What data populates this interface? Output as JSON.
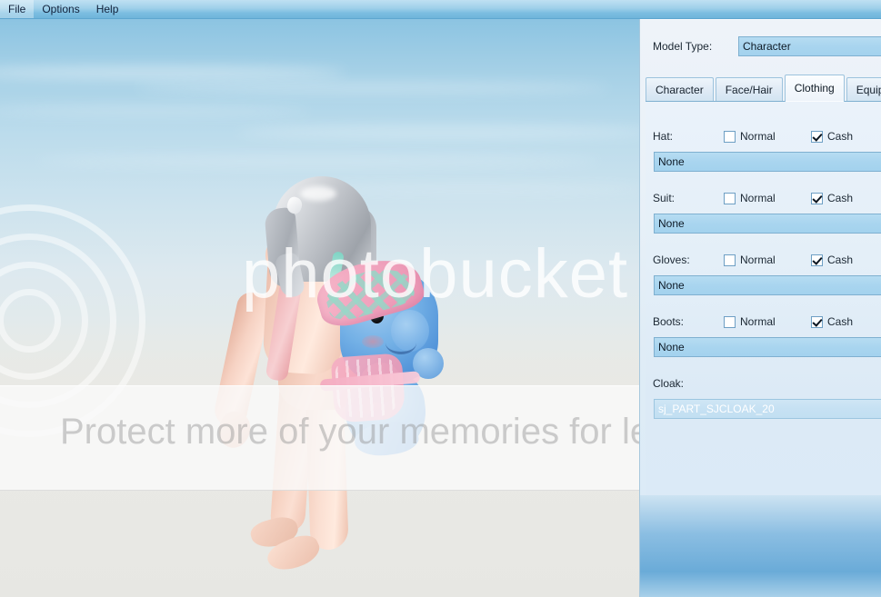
{
  "menubar": {
    "items": [
      {
        "label": "File"
      },
      {
        "label": "Options"
      },
      {
        "label": "Help"
      }
    ]
  },
  "watermark": {
    "brand": "photobucket",
    "tagline": "Protect more of your memories for less!"
  },
  "panel": {
    "model_type": {
      "label": "Model Type:",
      "value": "Character"
    },
    "tabs": [
      {
        "label": "Character",
        "active": false
      },
      {
        "label": "Face/Hair",
        "active": false
      },
      {
        "label": "Clothing",
        "active": true
      },
      {
        "label": "Equipm",
        "active": false
      }
    ],
    "clothing": {
      "slots": [
        {
          "label": "Hat:",
          "normal_label": "Normal",
          "normal_checked": false,
          "cash_label": "Cash",
          "cash_checked": true,
          "value": "None",
          "selected": false
        },
        {
          "label": "Suit:",
          "normal_label": "Normal",
          "normal_checked": false,
          "cash_label": "Cash",
          "cash_checked": true,
          "value": "None",
          "selected": false
        },
        {
          "label": "Gloves:",
          "normal_label": "Normal",
          "normal_checked": false,
          "cash_label": "Cash",
          "cash_checked": true,
          "value": "None",
          "selected": false
        },
        {
          "label": "Boots:",
          "normal_label": "Normal",
          "normal_checked": false,
          "cash_label": "Cash",
          "cash_checked": true,
          "value": "None",
          "selected": false
        }
      ],
      "cloak": {
        "label": "Cloak:",
        "value": "sj_PART_SJCLOAK_20",
        "selected": true
      }
    }
  },
  "colors": {
    "accent": "#6aabd8",
    "panel_bg": "#e4eff8",
    "combo_bg": "#a9d5ef",
    "menubar": "#9fd0ea",
    "text": "#1b2733"
  }
}
